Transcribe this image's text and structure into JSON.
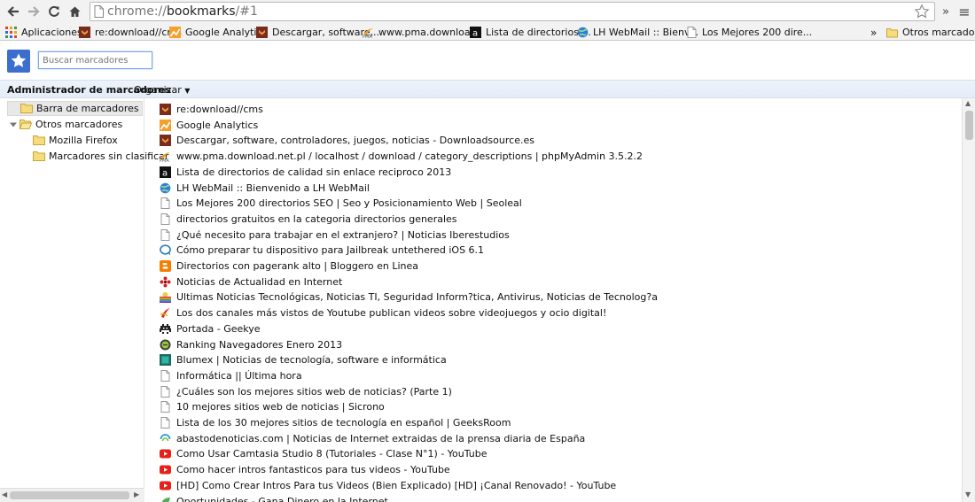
{
  "toolbar": {
    "url_scheme": "chrome://",
    "url_host": "bookmarks",
    "url_path": "/#1",
    "overflow": "»",
    "menu": "≡"
  },
  "bookmarks_bar": {
    "items": [
      {
        "label": "Aplicaciones",
        "icon": "apps-grid-icon"
      },
      {
        "label": "re:download//cms",
        "icon": "site-favicon"
      },
      {
        "label": "Google Analytics",
        "icon": "analytics-icon"
      },
      {
        "label": "Descargar, software,...",
        "icon": "site-favicon"
      },
      {
        "label": "www.pma.downloa...",
        "icon": "pma-icon"
      },
      {
        "label": "Lista de directorios ...",
        "icon": "site-favicon"
      },
      {
        "label": "LH WebMail :: Bienv...",
        "icon": "globe-icon"
      },
      {
        "label": "Los Mejores 200 dire...",
        "icon": "page-icon"
      }
    ],
    "overflow": "»",
    "other_label": "Otros marcadores"
  },
  "search": {
    "placeholder": "Buscar marcadores"
  },
  "manager": {
    "title": "Administrador de marcadores",
    "organize": "Organizar"
  },
  "tree": {
    "items": [
      {
        "label": "Barra de marcadores"
      },
      {
        "label": "Otros marcadores"
      },
      {
        "label": "Mozilla Firefox"
      },
      {
        "label": "Marcadores sin clasificar"
      }
    ]
  },
  "bookmarks": [
    {
      "title": "re:download//cms",
      "icon": "orange-chevron-icon"
    },
    {
      "title": "Google Analytics",
      "icon": "analytics-icon"
    },
    {
      "title": "Descargar, software, controladores, juegos, noticias - Downloadsource.es",
      "icon": "orange-chevron-icon"
    },
    {
      "title": "www.pma.download.net.pl / localhost / download / category_descriptions | phpMyAdmin 3.5.2.2",
      "icon": "pma-icon"
    },
    {
      "title": "Lista de directorios de calidad sin enlace reciproco 2013",
      "icon": "black-a-icon"
    },
    {
      "title": "LH WebMail :: Bienvenido a LH WebMail",
      "icon": "globe-icon"
    },
    {
      "title": "Los Mejores 200 directorios SEO | Seo y Posicionamiento Web | Seoleal",
      "icon": "page-icon"
    },
    {
      "title": "directorios gratuitos en la categoria directorios generales",
      "icon": "page-icon"
    },
    {
      "title": "¿Qué necesito para trabajar en el extranjero? | Noticias Iberestudios",
      "icon": "page-icon"
    },
    {
      "title": "Cómo preparar tu dispositivo para Jailbreak untethered iOS 6.1",
      "icon": "speech-bubble-icon"
    },
    {
      "title": "Directorios con pagerank alto | Bloggero en Linea",
      "icon": "blogger-icon"
    },
    {
      "title": "Noticias de Actualidad en Internet",
      "icon": "red-flower-icon"
    },
    {
      "title": "Ultimas Noticias Tecnológicas, Noticias TI, Seguridad Inform?tica, Antivirus, Noticias de Tecnolog?a",
      "icon": "rainbow-icon"
    },
    {
      "title": "Los dos canales más vistos de Youtube publican videos sobre videojuegos y ocio digital!",
      "icon": "red-swoosh-icon"
    },
    {
      "title": "Portada - Geekye",
      "icon": "invader-icon"
    },
    {
      "title": "Ranking Navegadores Enero 2013",
      "icon": "green-circle-icon"
    },
    {
      "title": "Blumex | Noticias de tecnología, software e informática",
      "icon": "teal-square-icon"
    },
    {
      "title": "Informática || Última hora",
      "icon": "page-icon"
    },
    {
      "title": "¿Cuáles son los mejores sitios web de noticias? (Parte 1)",
      "icon": "page-icon"
    },
    {
      "title": "10 mejores sitios web de noticias | Sicrono",
      "icon": "page-icon"
    },
    {
      "title": "Lista de los 30 mejores sitios de tecnología en español | GeeksRoom",
      "icon": "page-icon"
    },
    {
      "title": "abastodenoticias.com | Noticias de Internet extraidas de la prensa diaria de España",
      "icon": "swirl-icon"
    },
    {
      "title": "Como Usar Camtasia Studio 8 (Tutoriales - Clase N°1) - YouTube",
      "icon": "youtube-icon"
    },
    {
      "title": "Como hacer intros fantasticos para tus videos - YouTube",
      "icon": "youtube-icon"
    },
    {
      "title": "[HD] Como Crear Intros Para tus Videos (Bien Explicado) [HD] ¡Canal Renovado! - YouTube",
      "icon": "youtube-icon"
    },
    {
      "title": "Oportunidades - Gana Dinero en la Internet",
      "icon": "green-leaf-icon"
    }
  ]
}
